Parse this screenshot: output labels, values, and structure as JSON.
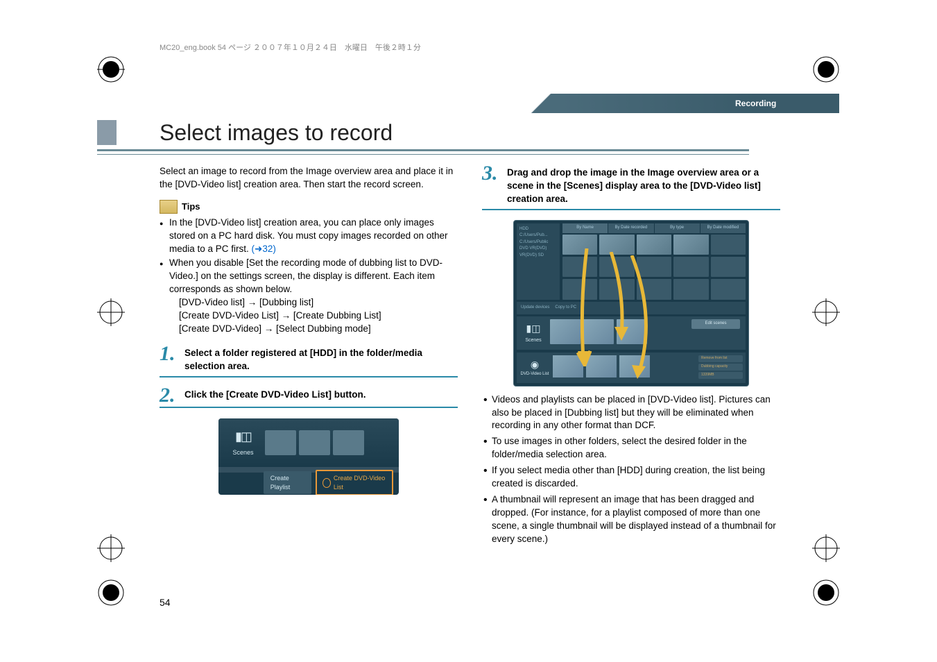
{
  "book_info": "MC20_eng.book  54 ページ  ２００７年１０月２４日　水曜日　午後２時１分",
  "header_label": "Recording",
  "title": "Select images to record",
  "intro": "Select an image to record from the Image overview area and place it in the [DVD-Video list] creation area. Then start the record screen.",
  "tips_label": "Tips",
  "tips": [
    {
      "main": "In the [DVD-Video list] creation area, you can place only images stored on a PC hard disk. You must copy images recorded on other media to a PC first. ",
      "link": "(➜32)"
    },
    {
      "main": "When you disable [Set the recording mode of dubbing list to DVD-Video.] on the  settings screen, the display is different. Each item corresponds as shown below.",
      "sub1": "[DVD-Video list] → [Dubbing list]",
      "sub2": "[Create DVD-Video List] → [Create Dubbing List]",
      "sub3": "[Create DVD-Video] → [Select Dubbing mode]"
    }
  ],
  "steps": [
    {
      "num": "1.",
      "text": "Select a folder registered at [HDD] in the folder/media selection area."
    },
    {
      "num": "2.",
      "text": "Click the [Create DVD-Video List] button."
    },
    {
      "num": "3.",
      "text": "Drag and drop the image in the Image overview area or a scene in the [Scenes] display area to the [DVD-Video list] creation area."
    }
  ],
  "sc1": {
    "scenes_label": "Scenes",
    "btn1": "Create Playlist",
    "btn2": "Create DVD-Video List"
  },
  "sc2": {
    "tree": "HDD\n  C:/Users/Pub...\n  C:/Users/Public\nDVD\n  VR(DVD)\n  VR(DVD)\nSD\n",
    "tabs": [
      "By Name",
      "By Date recorded",
      "By type",
      "By Date modified"
    ],
    "update": "Update devices",
    "copy": "Copy to PC",
    "scenes_label": "Scenes",
    "edit": "Edit scenes",
    "bottom_label": "DVD-Video List",
    "rbtn1": "Remove from list",
    "rbtn2": "Dubbing capacity",
    "rbtn3": "1339MB"
  },
  "sub_bullets": [
    "Videos and playlists can be placed in [DVD-Video list]. Pictures can also be placed in [Dubbing list] but they will be eliminated when recording in any other format than DCF.",
    "To use images in other folders, select the desired folder in the folder/media selection area.",
    "If you select media other than [HDD] during creation, the list being created is discarded.",
    "A thumbnail will represent an image that has been dragged and dropped. (For instance, for a playlist composed of more than one scene, a single thumbnail will be displayed instead of a thumbnail for every scene.)"
  ],
  "page_num": "54"
}
